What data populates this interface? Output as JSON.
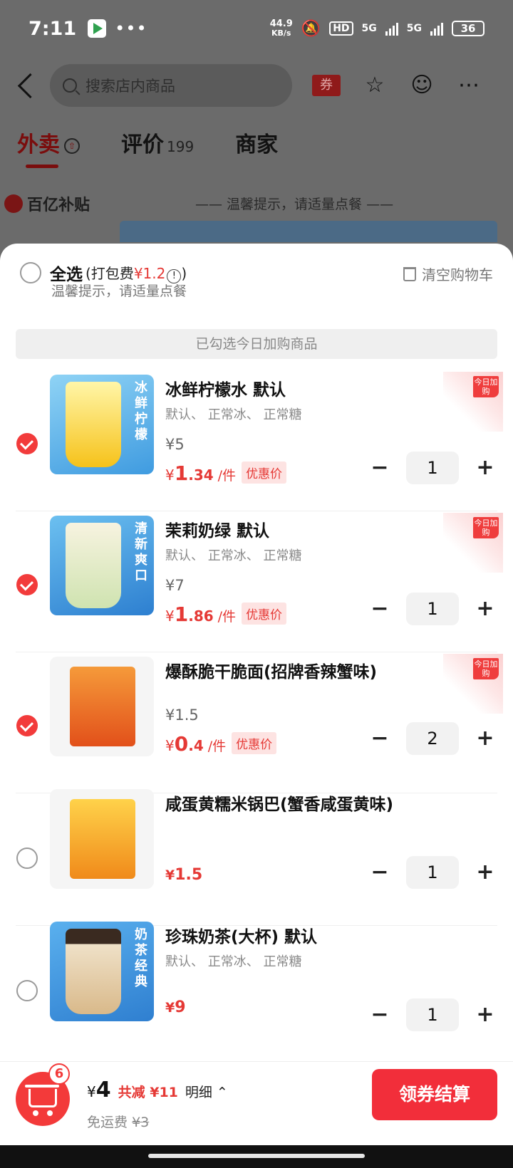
{
  "status_bar": {
    "time": "7:11",
    "speed_value": "44.9",
    "speed_unit": "KB/s",
    "hd": "HD",
    "net1": "5G",
    "net2": "5G",
    "battery": "36"
  },
  "header": {
    "search_placeholder": "搜索店内商品",
    "coupon_label": "券"
  },
  "tabs": [
    {
      "label": "外卖",
      "active": true
    },
    {
      "label": "评价",
      "count": "199"
    },
    {
      "label": "商家"
    }
  ],
  "background": {
    "subsidy": "百亿补贴",
    "tip": "—— 温馨提示，请适量点餐 ——"
  },
  "cart": {
    "select_all": "全选",
    "packing_prefix": "(打包费",
    "packing_fee": "¥1.2",
    "packing_suffix": ")",
    "clear": "清空购物车",
    "tip": "温馨提示，请适量点餐",
    "section_title": "已勾选今日加购商品",
    "items": [
      {
        "name": "冰鲜柠檬水 默认",
        "spec": "默认、 正常冰、 正常糖",
        "original_price": "¥5",
        "deal_yen": "¥",
        "deal_int": "1",
        "deal_dec": ".34",
        "per": "/件",
        "tag": "优惠价",
        "quantity": "1",
        "checked": true,
        "ribbon": "今日加购",
        "thumb_text": "冰鲜柠檬",
        "thumb_color": "#f6c21a"
      },
      {
        "name": "茉莉奶绿 默认",
        "spec": "默认、 正常冰、 正常糖",
        "original_price": "¥7",
        "deal_yen": "¥",
        "deal_int": "1",
        "deal_dec": ".86",
        "per": "/件",
        "tag": "优惠价",
        "quantity": "1",
        "checked": true,
        "ribbon": "今日加购",
        "thumb_text": "清新爽口",
        "thumb_color": "#3a8fd6"
      },
      {
        "name": "爆酥脆干脆面(招牌香辣蟹味)",
        "spec": "",
        "original_price": "¥1.5",
        "deal_yen": "¥",
        "deal_int": "0",
        "deal_dec": ".4",
        "per": "/件",
        "tag": "优惠价",
        "quantity": "2",
        "checked": true,
        "ribbon": "今日加购",
        "thumb_color": "#f07a1a"
      },
      {
        "name": "咸蛋黄糯米锅巴(蟹香咸蛋黄味)",
        "spec": "",
        "price_yen": "¥",
        "price": "1.5",
        "quantity": "1",
        "checked": false,
        "thumb_color": "#f3a91c"
      },
      {
        "name": "珍珠奶茶(大杯) 默认",
        "spec": "默认、 正常冰、 正常糖",
        "price_yen": "¥",
        "price": "9",
        "quantity": "1",
        "checked": false,
        "thumb_text": "奶茶经典",
        "thumb_color": "#2f7fd0"
      }
    ]
  },
  "bottom": {
    "badge": "6",
    "total_yen": "¥",
    "total": "4",
    "save": "共减 ¥11",
    "detail": "明细 ⌃",
    "fee_label": "免运费",
    "fee_orig": "¥3",
    "checkout": "领券结算"
  },
  "colors": {
    "accent": "#f23b3b",
    "price": "#e53935"
  }
}
